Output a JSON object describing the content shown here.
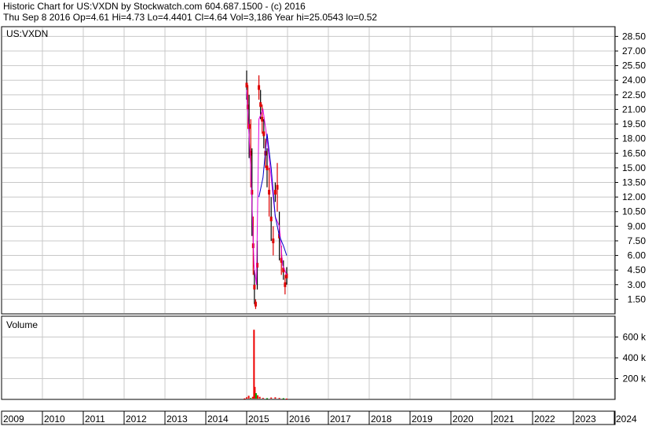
{
  "header": {
    "line1": "Historic Chart for US:VXDN by Stockwatch.com 604.687.1500 - (c) 2016",
    "line2": "Thu Sep  8 2016  Op=4.61  Hi=4.73  Lo=4.4401  Cl=4.64  Vol=3,186  Year hi=25.0543  lo=0.52"
  },
  "chart_data": [
    {
      "type": "candlestick",
      "title": "US:VXDN",
      "x_labels": [
        "2009",
        "2010",
        "2011",
        "2012",
        "2013",
        "2014",
        "2015",
        "2016",
        "2017",
        "2018",
        "2019",
        "2020",
        "2021",
        "2022",
        "2023",
        "2024"
      ],
      "xlim": [
        2009,
        2024.4
      ],
      "ylim": [
        0,
        29.5
      ],
      "y_ticks": [
        "28.50",
        "27.00",
        "25.50",
        "24.00",
        "22.50",
        "21.00",
        "19.50",
        "18.00",
        "16.50",
        "15.00",
        "13.50",
        "12.00",
        "10.50",
        "9.00",
        "7.50",
        "6.00",
        "4.50",
        "3.00",
        "1.50"
      ],
      "grid": true,
      "colors": {
        "up": "#000000",
        "down": "#dd0000",
        "ma_fast": "#e000e0",
        "ma_slow": "#0000cc",
        "grid": "#c8c8c8"
      },
      "price_series": [
        {
          "x": 2015.0,
          "h": 25.0,
          "l": 22.0
        },
        {
          "x": 2015.03,
          "h": 23.5,
          "l": 19.0
        },
        {
          "x": 2015.06,
          "h": 22.5,
          "l": 16.0
        },
        {
          "x": 2015.1,
          "h": 20.0,
          "l": 13.0
        },
        {
          "x": 2015.13,
          "h": 17.0,
          "l": 8.0
        },
        {
          "x": 2015.16,
          "h": 10.0,
          "l": 4.0
        },
        {
          "x": 2015.19,
          "h": 4.5,
          "l": 1.0
        },
        {
          "x": 2015.22,
          "h": 1.5,
          "l": 0.5
        },
        {
          "x": 2015.26,
          "h": 7.5,
          "l": 2.5
        },
        {
          "x": 2015.3,
          "h": 24.5,
          "l": 22.0
        },
        {
          "x": 2015.34,
          "h": 23.0,
          "l": 20.0
        },
        {
          "x": 2015.38,
          "h": 21.5,
          "l": 18.5
        },
        {
          "x": 2015.42,
          "h": 20.0,
          "l": 17.0
        },
        {
          "x": 2015.46,
          "h": 18.0,
          "l": 15.0
        },
        {
          "x": 2015.5,
          "h": 17.0,
          "l": 13.0
        },
        {
          "x": 2015.55,
          "h": 15.0,
          "l": 10.0
        },
        {
          "x": 2015.6,
          "h": 12.0,
          "l": 7.5
        },
        {
          "x": 2015.65,
          "h": 9.0,
          "l": 6.0
        },
        {
          "x": 2015.7,
          "h": 13.5,
          "l": 11.5
        },
        {
          "x": 2015.75,
          "h": 15.5,
          "l": 10.5
        },
        {
          "x": 2015.8,
          "h": 10.5,
          "l": 5.5
        },
        {
          "x": 2015.85,
          "h": 7.0,
          "l": 4.0
        },
        {
          "x": 2015.9,
          "h": 5.5,
          "l": 3.5
        },
        {
          "x": 2015.94,
          "h": 4.0,
          "l": 2.0
        },
        {
          "x": 2015.98,
          "h": 4.8,
          "l": 3.0
        }
      ],
      "ma_fast": [
        {
          "x": 2015.0,
          "y": 23.0
        },
        {
          "x": 2015.1,
          "y": 15.0
        },
        {
          "x": 2015.18,
          "y": 5.0
        },
        {
          "x": 2015.24,
          "y": 3.0
        },
        {
          "x": 2015.3,
          "y": 20.0
        },
        {
          "x": 2015.4,
          "y": 21.0
        },
        {
          "x": 2015.5,
          "y": 18.0
        },
        {
          "x": 2015.6,
          "y": 14.0
        },
        {
          "x": 2015.7,
          "y": 10.0
        },
        {
          "x": 2015.8,
          "y": 9.0
        },
        {
          "x": 2015.88,
          "y": 5.0
        },
        {
          "x": 2015.98,
          "y": 4.0
        }
      ],
      "ma_slow": [
        {
          "x": 2015.3,
          "y": 12.0
        },
        {
          "x": 2015.4,
          "y": 14.0
        },
        {
          "x": 2015.5,
          "y": 18.5
        },
        {
          "x": 2015.6,
          "y": 15.0
        },
        {
          "x": 2015.7,
          "y": 10.0
        },
        {
          "x": 2015.8,
          "y": 8.0
        },
        {
          "x": 2015.9,
          "y": 7.0
        },
        {
          "x": 2015.98,
          "y": 6.0
        }
      ]
    },
    {
      "type": "bar",
      "title": "Volume",
      "xlim": [
        2009,
        2024.4
      ],
      "ylim": [
        0,
        800000
      ],
      "y_ticks": [
        "600 k",
        "400 k",
        "200 k"
      ],
      "y_tick_values": [
        600000,
        400000,
        200000
      ],
      "grid": true,
      "colors": {
        "bar": "#ee0000",
        "bar_alt": "#00aa00"
      },
      "bars": [
        {
          "x": 2014.95,
          "v": 10000
        },
        {
          "x": 2015.0,
          "v": 20000
        },
        {
          "x": 2015.05,
          "v": 35000
        },
        {
          "x": 2015.1,
          "v": 15000
        },
        {
          "x": 2015.15,
          "v": 25000
        },
        {
          "x": 2015.18,
          "v": 670000
        },
        {
          "x": 2015.2,
          "v": 120000
        },
        {
          "x": 2015.23,
          "v": 60000
        },
        {
          "x": 2015.27,
          "v": 40000
        },
        {
          "x": 2015.32,
          "v": 25000
        },
        {
          "x": 2015.4,
          "v": 15000
        },
        {
          "x": 2015.5,
          "v": 12000
        },
        {
          "x": 2015.6,
          "v": 18000
        },
        {
          "x": 2015.7,
          "v": 20000
        },
        {
          "x": 2015.8,
          "v": 14000
        },
        {
          "x": 2015.9,
          "v": 12000
        },
        {
          "x": 2015.98,
          "v": 8000
        }
      ]
    }
  ]
}
